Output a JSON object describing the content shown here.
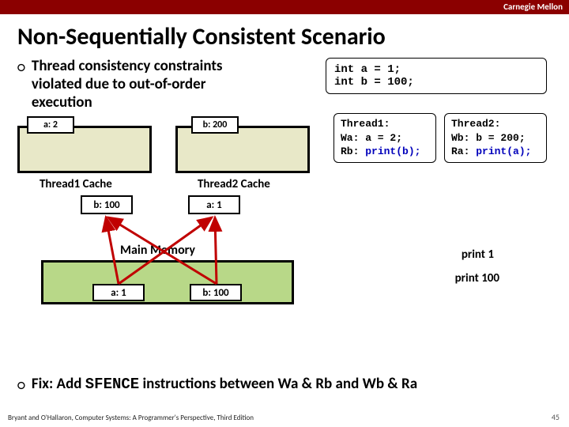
{
  "header": {
    "brand": "Carnegie Mellon"
  },
  "title": "Non-Sequentially Consistent Scenario",
  "bullet1": "Thread consistency constraints violated due to out-of-order execution",
  "init": {
    "line1": "int a = 1;",
    "line2": "int b = 100;"
  },
  "thread1": {
    "name": "Thread1:",
    "wa": "Wa: a = 2;",
    "rb_pre": "Rb: ",
    "rb_call": "print(b);"
  },
  "thread2": {
    "name": "Thread2:",
    "wb": "Wb: b = 200;",
    "ra_pre": "Ra: ",
    "ra_call": "print(a);"
  },
  "diagram": {
    "reg_a": "a: 2",
    "reg_b": "b: 200",
    "cache1_label": "Thread1 Cache",
    "cache2_label": "Thread2 Cache",
    "cache1_val": "b: 100",
    "cache2_val": "a: 1",
    "mem_label": "Main Memory",
    "mem_a": "a: 1",
    "mem_b": "b: 100"
  },
  "prints": {
    "p1": "print 1",
    "p2": "print 100"
  },
  "fix": {
    "pre": "Fix: Add ",
    "instr": "SFENCE",
    "post": " instructions between Wa & Rb and Wb & Ra"
  },
  "footer": "Bryant and O'Hallaron, Computer Systems: A Programmer's Perspective, Third Edition",
  "page": "45"
}
